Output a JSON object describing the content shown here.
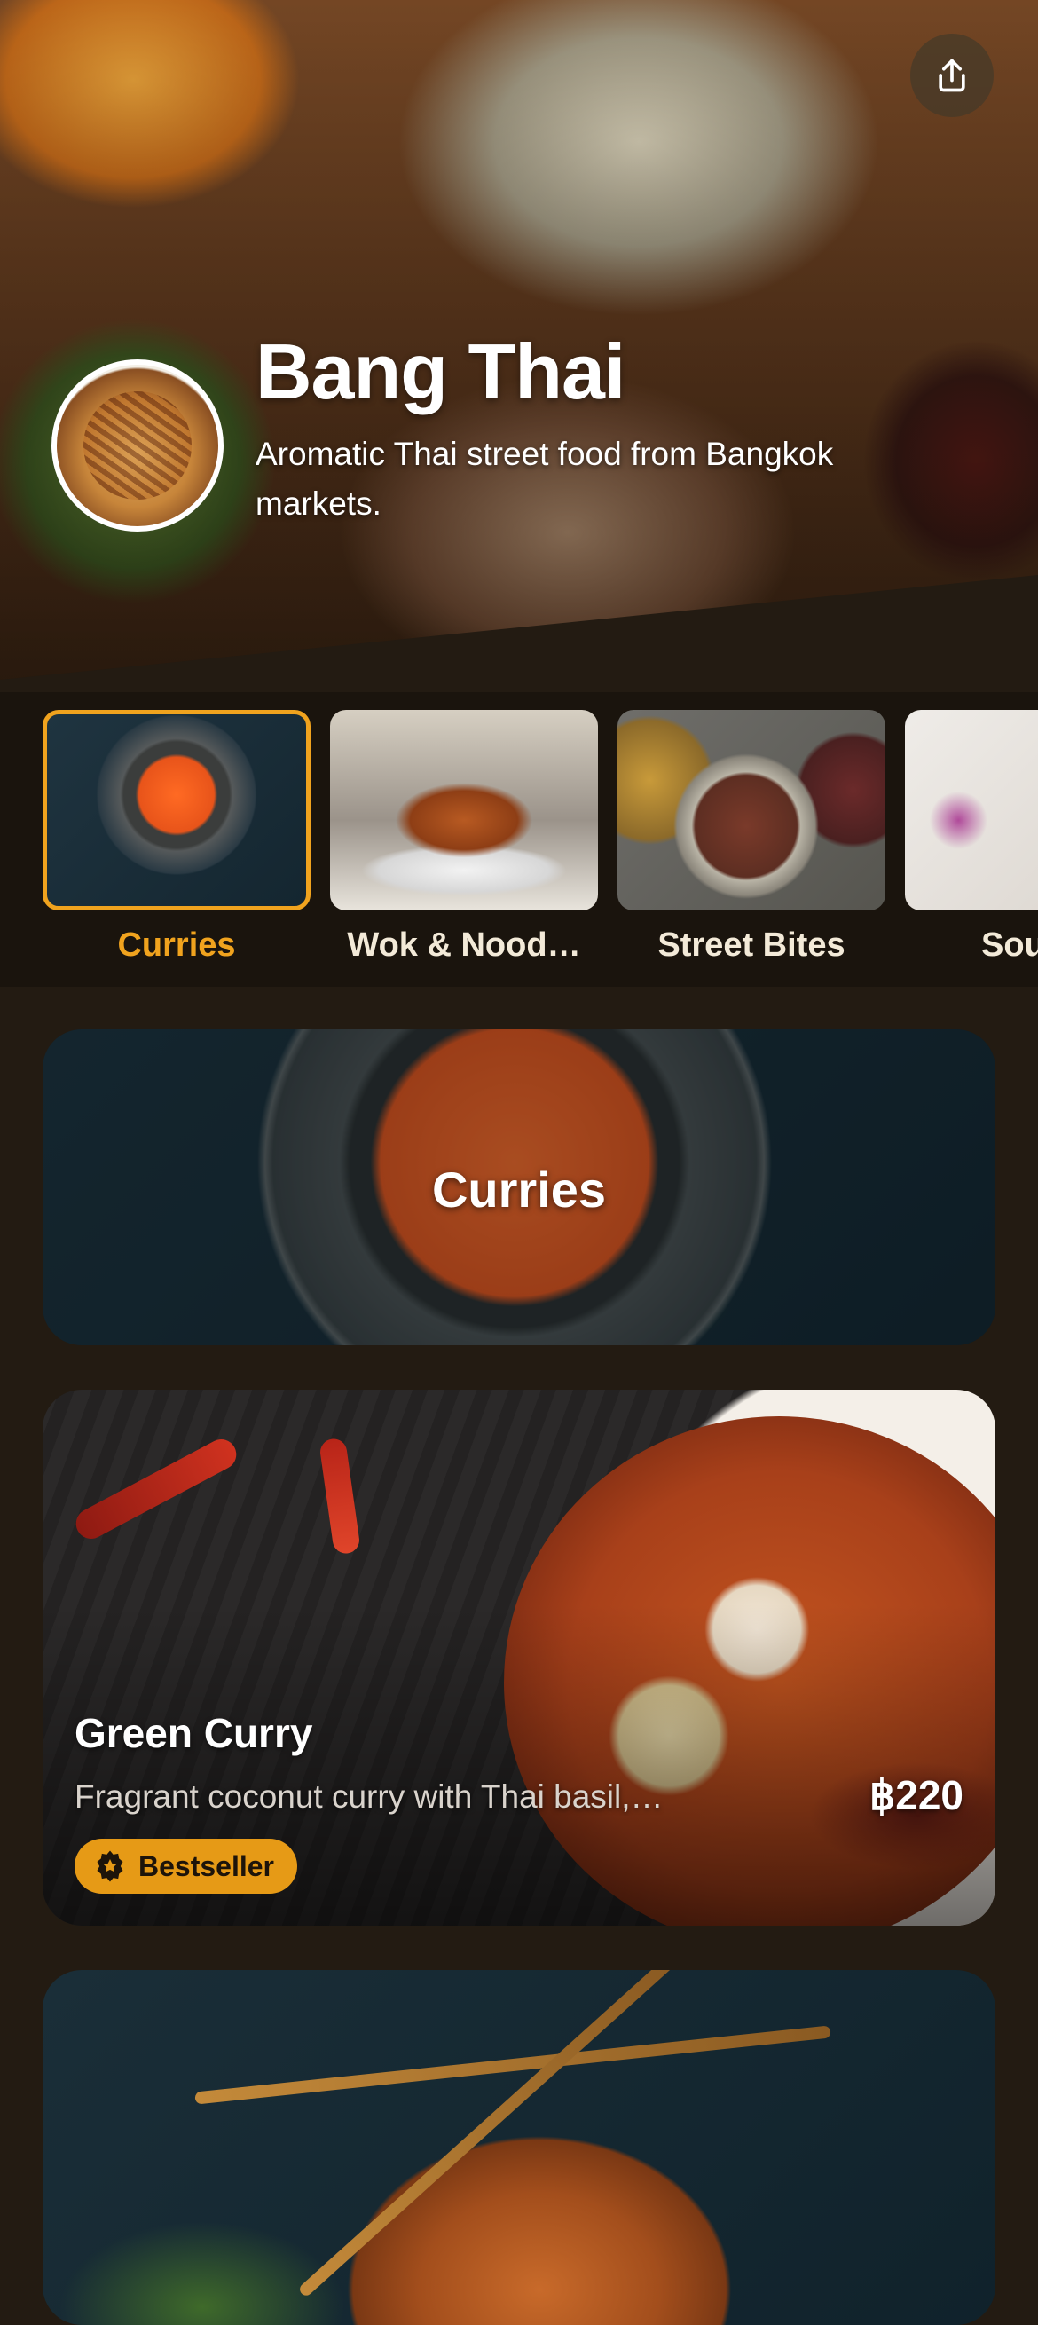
{
  "header": {
    "restaurant_name": "Bang Thai",
    "tagline": "Aromatic Thai street food from Bangkok markets.",
    "share_icon": "share-icon"
  },
  "categories": {
    "active": "Curries",
    "items": [
      {
        "label": "Curries",
        "active": true
      },
      {
        "label": "Wok & Nood…",
        "active": false
      },
      {
        "label": "Street Bites",
        "active": false
      },
      {
        "label": "Sou",
        "active": false
      }
    ]
  },
  "section": {
    "title": "Curries"
  },
  "menu_items": [
    {
      "name": "Green Curry",
      "description": "Fragrant coconut curry with Thai basil,…",
      "price": "฿220",
      "badge": {
        "label": "Bestseller",
        "icon": "badge-star-icon"
      }
    }
  ],
  "colors": {
    "accent": "#f0a31e",
    "badge_bg": "#e69a16",
    "background": "#231b12",
    "strip_bg": "#1a140d"
  }
}
